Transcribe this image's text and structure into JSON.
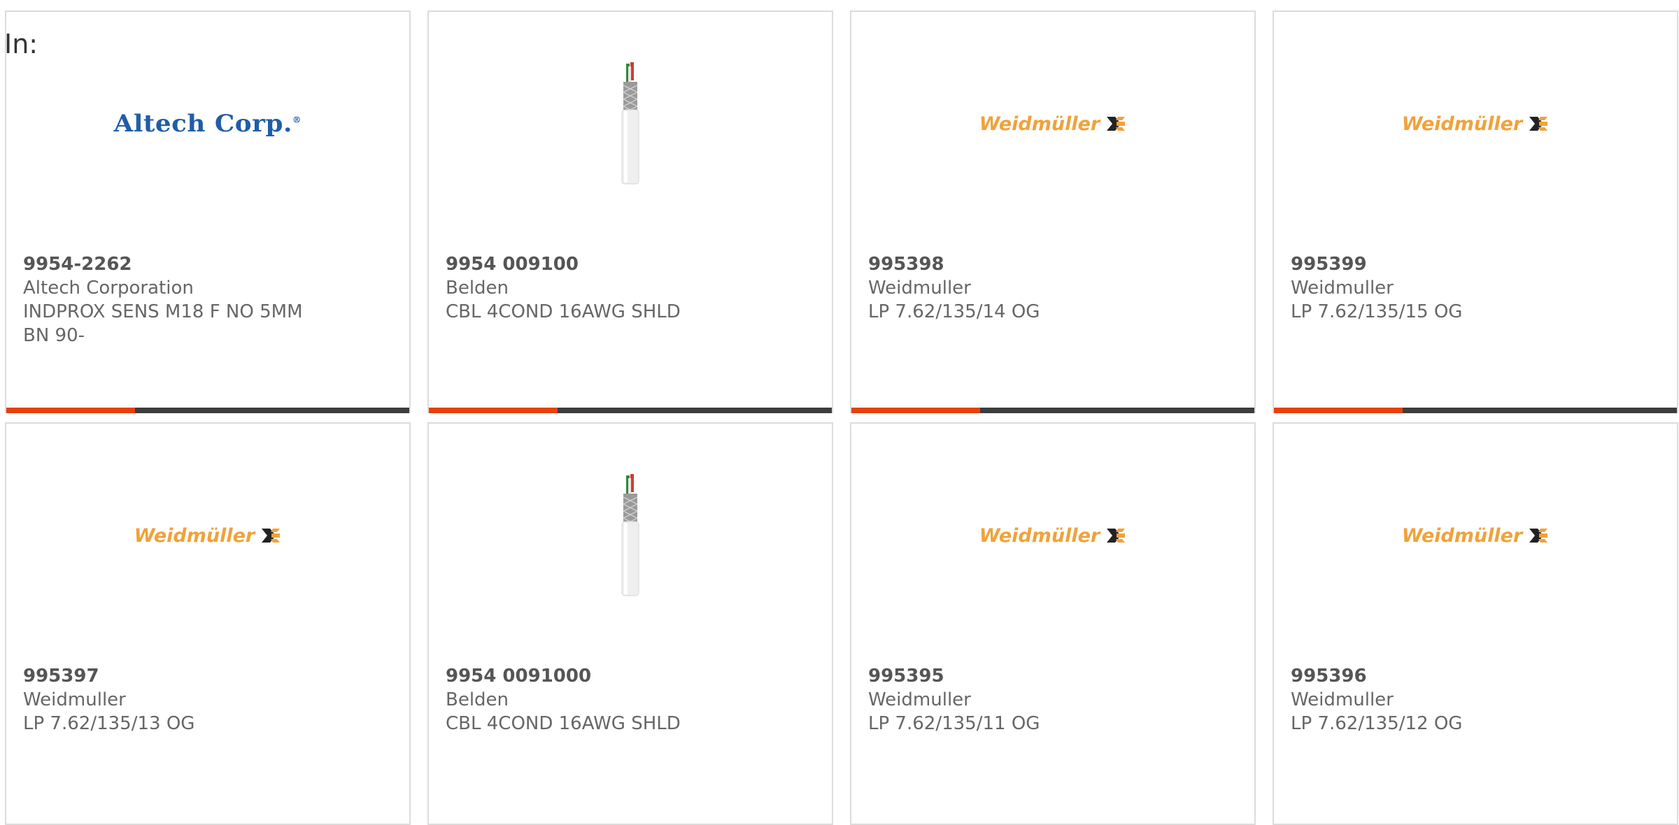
{
  "filter_label": "In:",
  "colors": {
    "accent": "#e8400c",
    "progress_track": "#3d3d3d",
    "altech_blue": "#1f5da8",
    "weidmuller_orange": "#f0a23a"
  },
  "products": [
    {
      "image": "altech-logo",
      "logo_text": "Altech Corp.",
      "part_number": "9954-2262",
      "manufacturer": "Altech Corporation",
      "description": "INDPROX SENS M18 F NO 5MM BN 90-",
      "progress": 0.32
    },
    {
      "image": "cable-photo",
      "part_number": "9954 009100",
      "manufacturer": "Belden",
      "description": "CBL 4COND 16AWG SHLD",
      "progress": 0.32
    },
    {
      "image": "weidmuller-logo",
      "logo_text": "Weidmüller",
      "part_number": "995398",
      "manufacturer": "Weidmuller",
      "description": "LP 7.62/135/14 OG",
      "progress": 0.32
    },
    {
      "image": "weidmuller-logo",
      "logo_text": "Weidmüller",
      "part_number": "995399",
      "manufacturer": "Weidmuller",
      "description": "LP 7.62/135/15 OG",
      "progress": 0.32
    },
    {
      "image": "weidmuller-logo",
      "logo_text": "Weidmüller",
      "part_number": "995397",
      "manufacturer": "Weidmuller",
      "description": "LP 7.62/135/13 OG"
    },
    {
      "image": "cable-photo",
      "part_number": "9954 0091000",
      "manufacturer": "Belden",
      "description": "CBL 4COND 16AWG SHLD"
    },
    {
      "image": "weidmuller-logo",
      "logo_text": "Weidmüller",
      "part_number": "995395",
      "manufacturer": "Weidmuller",
      "description": "LP 7.62/135/11 OG"
    },
    {
      "image": "weidmuller-logo",
      "logo_text": "Weidmüller",
      "part_number": "995396",
      "manufacturer": "Weidmuller",
      "description": "LP 7.62/135/12 OG"
    }
  ]
}
